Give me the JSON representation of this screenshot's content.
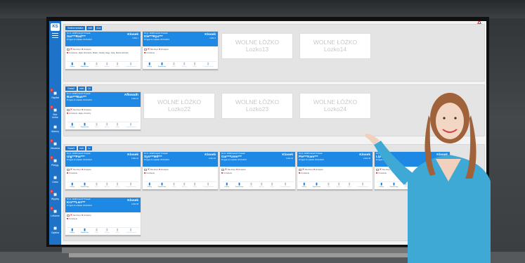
{
  "colors": {
    "accent": "#1e73c8",
    "card_header": "#1e88e5",
    "alert": "#e53935"
  },
  "app": {
    "logo": "KS"
  },
  "sidebar": {
    "items": [
      {
        "label": "Szpital",
        "icon": "hospital-icon",
        "badge": "1"
      },
      {
        "label": "Bez łóżka",
        "icon": "bed-cross-icon",
        "badge": "1"
      },
      {
        "label": "Alarmy",
        "icon": "bell-icon",
        "badge": ""
      },
      {
        "label": "Zlecenia",
        "icon": "list-icon",
        "badge": "1"
      },
      {
        "label": "Pielęg.",
        "icon": "nurse-icon",
        "badge": "1"
      },
      {
        "label": "Dieta",
        "icon": "food-icon",
        "badge": ""
      },
      {
        "label": "Wypisy",
        "icon": "person-icon",
        "badge": "1"
      },
      {
        "label": "Lekarze",
        "icon": "doctor-icon",
        "badge": "1"
      },
      {
        "label": "Opieka",
        "icon": "care-icon",
        "badge": ""
      }
    ]
  },
  "rooms": [
    {
      "name": "Sala1",
      "chips": [
        "edit",
        "A1a"
      ],
      "header_name": "Srdlomedala"
    },
    {
      "name": "Sala2",
      "chips": [
        "edit",
        "1b"
      ]
    },
    {
      "name": "Sala3",
      "chips": [
        "edit",
        "1c"
      ]
    }
  ],
  "free_beds": [
    {
      "title": "WOLNE ŁÓŻKO",
      "bed": "Lozko13"
    },
    {
      "title": "WOLNE ŁÓŻKO",
      "bed": "Lozko14"
    },
    {
      "title": "WOLNE ŁÓŻKO",
      "bed": "Lozko22"
    },
    {
      "title": "WOLNE ŁÓŻKO",
      "bed": "Lozko23"
    },
    {
      "title": "WOLNE ŁÓŻKO",
      "bed": "Lozko24"
    }
  ],
  "cards": [
    {
      "name": "Sar***Rad***",
      "doc": "Klosek",
      "line1": "Nr sz. 12345  Ioanch  Tirvasek",
      "line3": "Przyjęto do szpitala: 20-09-2021",
      "note": "Uczulenie: Jajka, Rosnacie, Mleko, Owady, Nagy, Soja, Słońce dziecko",
      "bed": "Łóżko 1"
    },
    {
      "name": "Kle***Ryu***",
      "doc": "Klosek",
      "line1": "Nr sz. 12345  Ioanch  Tirvasek",
      "line3": "Przyjęto do szpitala: 20-09-2021",
      "note": "Uczulenie",
      "bed": "Łóżko 2"
    },
    {
      "name": "Ban***Ban***",
      "doc": "Aflowath",
      "line1": "Nr sz. 12345  Ioanch  Tirvasek",
      "line3": "Przyjęto do szpitala: 20-09-2021",
      "note": "Uczulenie: Jajka, Orzechy",
      "bed": "Łóżko 21"
    },
    {
      "name": "Uig***Par***",
      "doc": "Klosek",
      "line1": "Nr sz. 12345  Ioanch  Tirvasek",
      "line3": "Przyjęto do szpitala: 20-09-2021",
      "note": "Uczulenie",
      "bed": "Łóżko 31"
    },
    {
      "name": "Syn***Mil***",
      "doc": "Klosek",
      "line1": "Nr sz. 12345  Ioanch  Tirvasek",
      "line3": "Przyjęto do szpitala: 20-09-2021",
      "note": "Uczulenie",
      "bed": "Łóżko 32"
    },
    {
      "name": "Gar***Unm***",
      "doc": "Klosek",
      "line1": "Nr sz. 12345  Ioanch  Tirvasek",
      "line3": "Przyjęto do szpitala: 20-09-2021",
      "note": "Uczulenie",
      "bed": "Łóżko 33"
    },
    {
      "name": "Pie***Kam***",
      "doc": "Klosek",
      "line1": "Nr sz. 12345  Ioanch  Tirvasek",
      "line3": "Przyjęto do szpitala: 20-09-2021",
      "note": "Uczulenie",
      "bed": "Łóżko 34"
    },
    {
      "name": "Lip***",
      "doc": "Klosek",
      "line1": "Nr sz. 12345",
      "line3": "Przyjęto do szpitala",
      "note": "Uczulenie",
      "bed": "Łóżko 35"
    },
    {
      "name": "Krz***Len***",
      "doc": "Klosek",
      "line1": "Nr sz. 12345  Ioanch  Tirvasek",
      "line3": "Przyjęto do szpitala: 20-09-2021",
      "note": "Uczulenie",
      "bed": "Łóżko 36"
    }
  ],
  "card_labels": {
    "no_order": "Nie dotyc",
    "restriction": "Zmiejsce",
    "icons": [
      "Zalecg",
      "Wywiad opt",
      "Dieta",
      "Alarmy",
      "Wizyt",
      "Przypominienie"
    ]
  }
}
